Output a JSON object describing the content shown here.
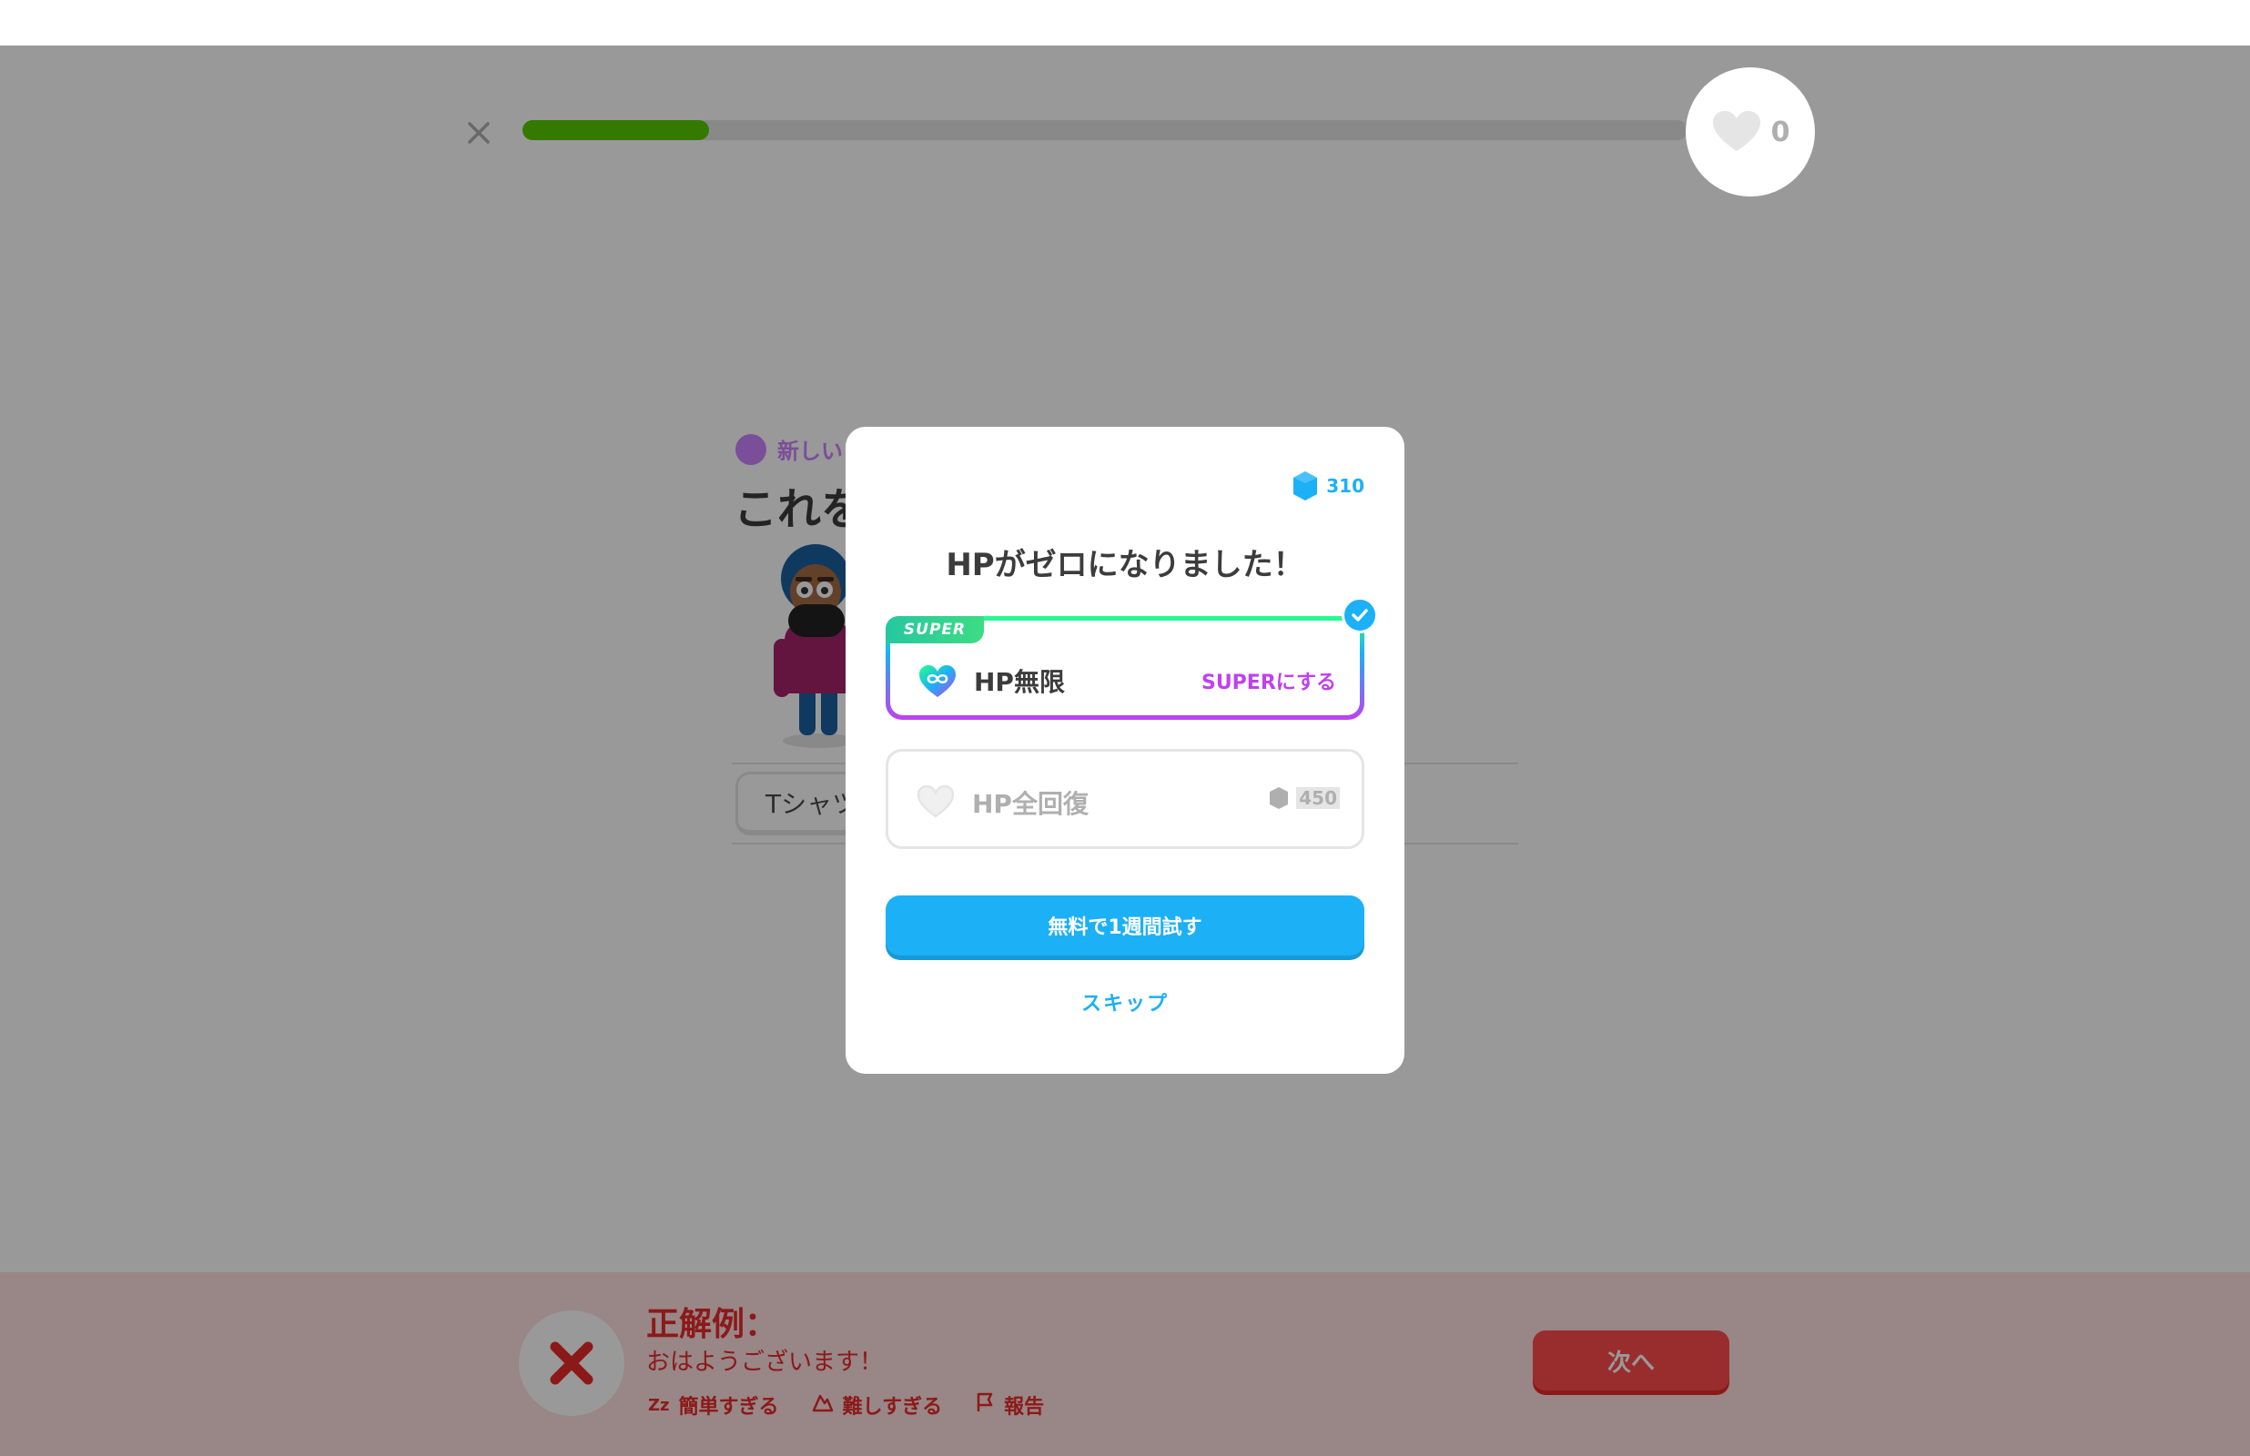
{
  "header": {
    "progress_fraction": 0.16,
    "hearts_count": "0"
  },
  "lesson": {
    "new_word_label": "新しい",
    "question": "これを",
    "answer_word": "Tシャツ"
  },
  "modal": {
    "gems_count": "310",
    "title": "HPがゼロになりました！",
    "super_option": {
      "tag": "SUPER",
      "label": "HP無限",
      "cta": "SUPERにする"
    },
    "refill_option": {
      "label": "HP全回復",
      "price": "450"
    },
    "primary_button": "無料で1週間試す",
    "skip_button": "スキップ"
  },
  "feedback": {
    "title": "正解例：",
    "answer": "おはようございます！",
    "actions": {
      "too_easy": "簡単すぎる",
      "too_hard": "難しすぎる",
      "report": "報告"
    },
    "next_button": "次へ"
  },
  "colors": {
    "progress": "#58cc02",
    "super_purple": "#c040f0",
    "blue": "#1cb0f6",
    "error_red": "#ea2b2b",
    "feedback_bg": "#ffdfe0"
  }
}
